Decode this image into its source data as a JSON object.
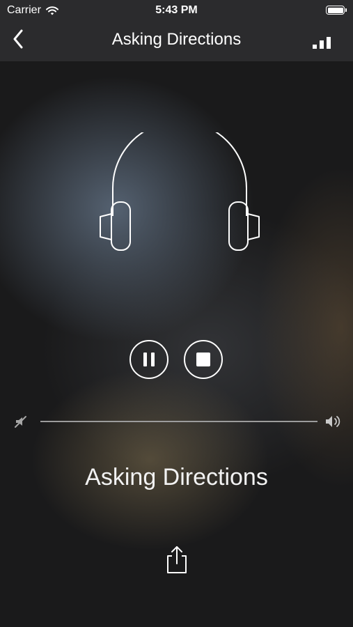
{
  "status_bar": {
    "carrier": "Carrier",
    "time": "5:43 PM",
    "wifi_icon": "wifi-icon",
    "battery_icon": "battery-icon"
  },
  "nav": {
    "title": "Asking Directions",
    "back_icon": "chevron-left-icon",
    "right_icon": "signal-bars-icon"
  },
  "player": {
    "artwork_icon": "headphones-icon",
    "pause_icon": "pause-icon",
    "stop_icon": "stop-icon",
    "volume_min_icon": "volume-mute-icon",
    "volume_max_icon": "volume-max-icon",
    "track_title": "Asking Directions",
    "share_icon": "share-icon"
  },
  "colors": {
    "nav_background": "#2b2b2d",
    "foreground": "#ffffff",
    "volume_track": "#9c9c9c"
  }
}
